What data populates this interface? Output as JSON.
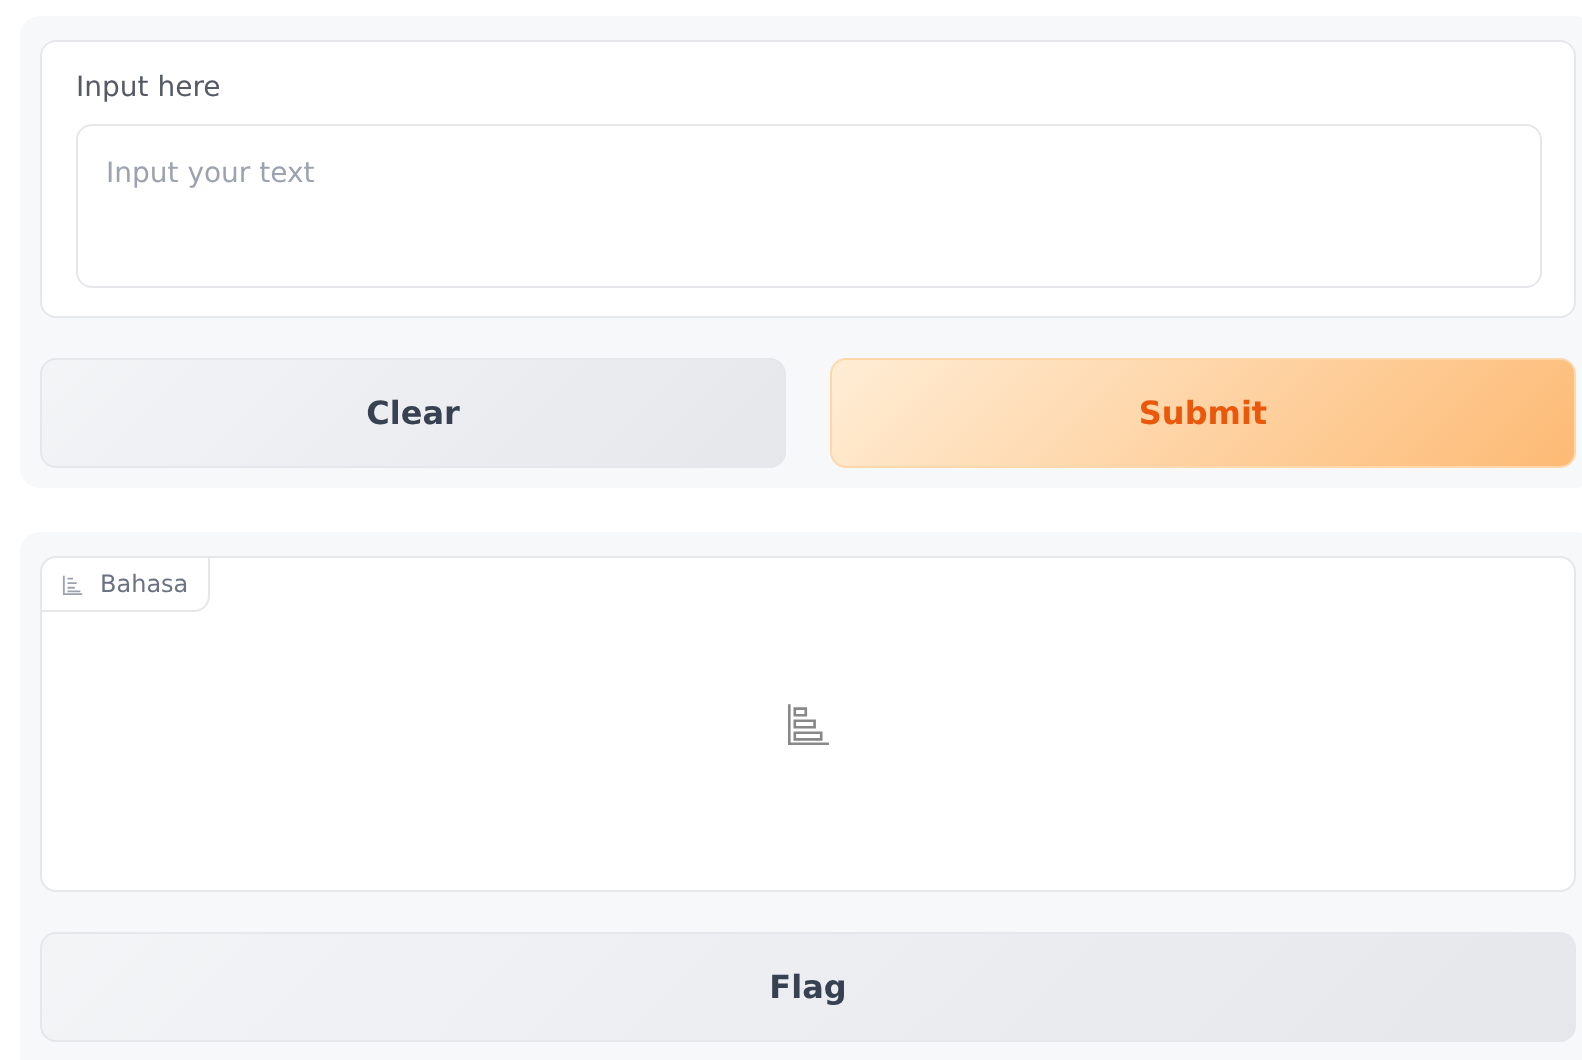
{
  "input_panel": {
    "label": "Input here",
    "placeholder": "Input your text",
    "buttons": [
      {
        "label": "Clear",
        "kind": "secondary"
      },
      {
        "label": "Submit",
        "kind": "primary"
      }
    ]
  },
  "output_panel": {
    "label": "Bahasa",
    "flag_button": "Flag"
  }
}
